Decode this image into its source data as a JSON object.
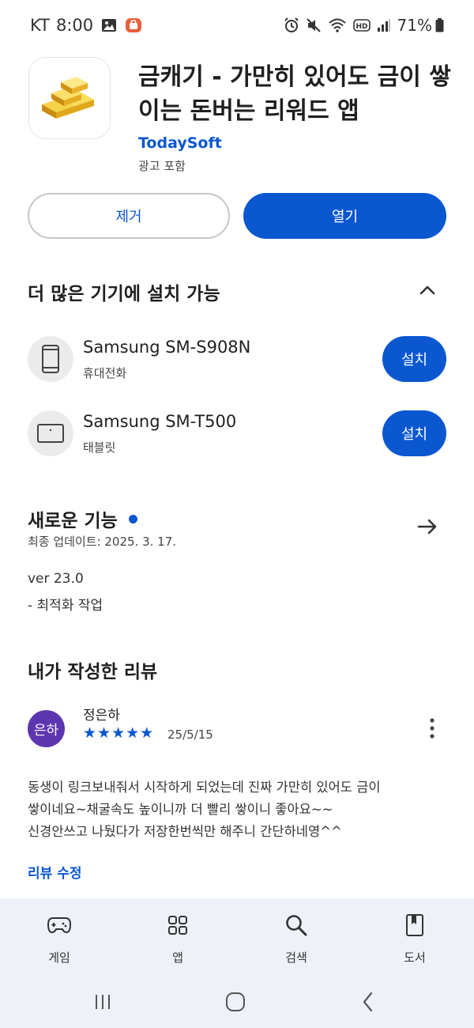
{
  "status_bar": {
    "carrier": "KT",
    "time": "8:00",
    "battery": "71%",
    "icons": [
      "image-icon",
      "notification-app-icon",
      "alarm-icon",
      "mute-icon",
      "wifi-icon",
      "hd-icon",
      "signal-icon",
      "battery-icon"
    ]
  },
  "app": {
    "title": "금캐기 - 가만히 있어도 금이 쌓이는 돈버는 리워드 앱",
    "developer": "TodaySoft",
    "ad_label": "광고 포함",
    "icon": "gold-bars-icon"
  },
  "actions": {
    "remove_label": "제거",
    "open_label": "열기"
  },
  "devices": {
    "title": "더 많은 기기에 설치 가능",
    "items": [
      {
        "name": "Samsung SM-S908N",
        "type": "휴대전화",
        "icon": "phone-icon",
        "install_label": "설치"
      },
      {
        "name": "Samsung SM-T500",
        "type": "태블릿",
        "icon": "tablet-icon",
        "install_label": "설치"
      }
    ]
  },
  "whats_new": {
    "title": "새로운 기능",
    "updated": "최종 업데이트: 2025. 3. 17.",
    "version": "ver 23.0",
    "note": "- 최적화 작업"
  },
  "my_review": {
    "title": "내가 작성한 리뷰",
    "avatar_text": "은하",
    "reviewer": "정은하",
    "stars": "★★★★★",
    "rating": 5,
    "date": "25/5/15",
    "body_lines": [
      "동생이 링크보내줘서 시작하게 되었는데 진짜 가만히 있어도 금이",
      "쌓이네요~채굴속도 높이니까 더 빨리 쌓이니 좋아요~~",
      "신경안쓰고 나뒀다가 저장한번씩만 해주니 간단하네영^^"
    ],
    "edit_label": "리뷰 수정"
  },
  "bottom_nav": {
    "items": [
      {
        "label": "게임",
        "icon": "gamepad-icon"
      },
      {
        "label": "앱",
        "icon": "apps-grid-icon"
      },
      {
        "label": "검색",
        "icon": "search-icon"
      },
      {
        "label": "도서",
        "icon": "book-icon"
      }
    ]
  },
  "colors": {
    "accent": "#0b57d0",
    "avatar": "#5e35b1",
    "nav_background": "#eef1f8",
    "gold": "#f2c12e"
  }
}
